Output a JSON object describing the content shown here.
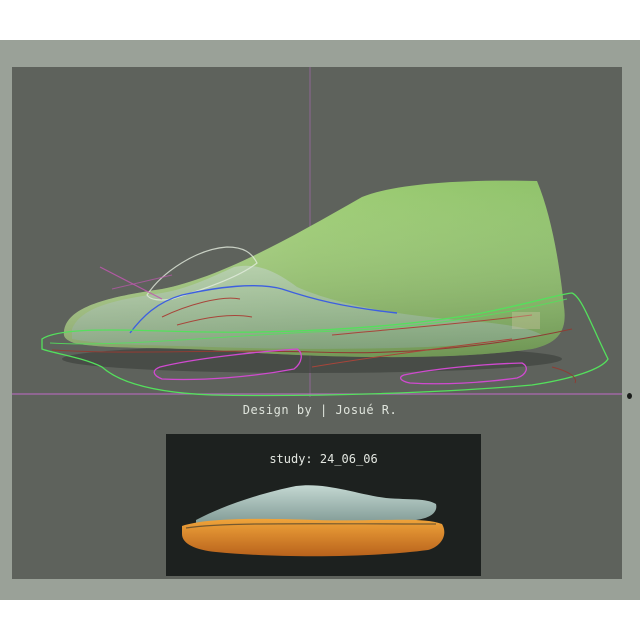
{
  "credit": {
    "text": "Design by | Josué R."
  },
  "preview": {
    "label": "study: 24_06_06"
  },
  "colors": {
    "background": "#5e625c",
    "frame": "#9aa198",
    "sole_outline": "#54e05c",
    "guide": "#c86ad0",
    "curve_blue": "#3d5fe0",
    "curve_magenta": "#d04ad0",
    "curve_red": "#a8453a",
    "last_green": "#a6d27e",
    "preview_bg": "#1d211f",
    "preview_sole": "#e08a2a",
    "preview_upper": "#a9c2bd"
  }
}
